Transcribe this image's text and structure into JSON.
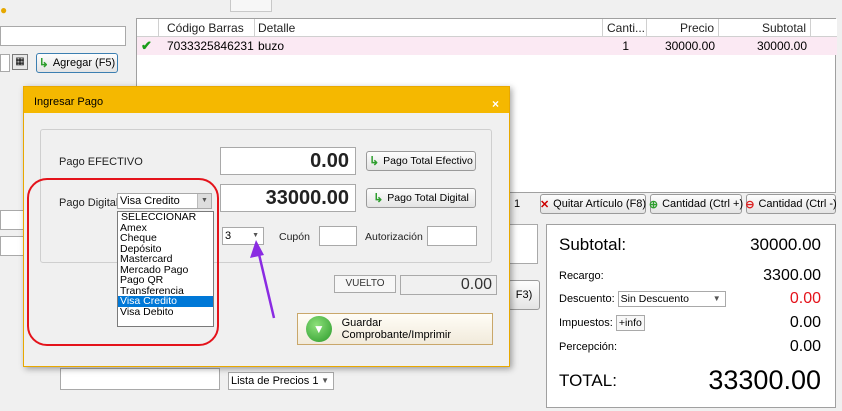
{
  "app": {
    "agregar_label": "Agregar (F5)",
    "calc_icon": "calculator-icon"
  },
  "grid": {
    "headers": [
      "Código Barras",
      "Detalle",
      "Canti...",
      "Precio",
      "Subtotal"
    ],
    "rows": [
      {
        "codigo": "7033325846231",
        "detalle": "buzo",
        "cantidad": "1",
        "precio": "30000.00",
        "subtotal": "30000.00"
      }
    ]
  },
  "toolbar": {
    "count": "1",
    "quitar": "Quitar Artículo (F8)",
    "cantidad_mas": "Cantidad (Ctrl +)",
    "cantidad_menos": "Cantidad (Ctrl -)"
  },
  "f3_label": "F3)",
  "totals": {
    "subtotal_label": "Subtotal:",
    "subtotal_value": "30000.00",
    "recargo_label": "Recargo:",
    "recargo_value": "3300.00",
    "descuento_label": "Descuento:",
    "descuento_select": "Sin Descuento",
    "descuento_value": "0.00",
    "impuestos_label": "Impuestos:",
    "impuestos_btn": "+info",
    "impuestos_value": "0.00",
    "percepcion_label": "Percepción:",
    "percepcion_value": "0.00",
    "total_label": "TOTAL:",
    "total_value": "33300.00"
  },
  "lista_precios": "Lista de Precios 1",
  "dialog": {
    "title": "Ingresar Pago",
    "close": "×",
    "efectivo_label": "Pago EFECTIVO",
    "efectivo_value": "0.00",
    "total_efectivo_btn": "Pago Total Efectivo",
    "digital_label": "Pago Digital",
    "digital_select": "Visa Credito",
    "digital_value": "33000.00",
    "total_digital_btn": "Pago Total Digital",
    "cuotas_value": "3",
    "cupon_label": "Cupón",
    "autorizacion_label": "Autorización",
    "vuelto_label": "VUELTO",
    "vuelto_value": "0.00",
    "guardar_label": "Guardar Comprobante/Imprimir",
    "options": [
      "SELECCIONAR",
      "Amex",
      "Cheque",
      "Depósito",
      "Mastercard",
      "Mercado Pago",
      "Pago QR",
      "Transferencia",
      "Visa Credito",
      "Visa Debito"
    ],
    "selected_option": "Visa Credito"
  },
  "colors": {
    "title_bar": "#f5b800",
    "annotation_ring": "#e4131b",
    "annotation_arrow": "#8a2be2",
    "selection": "#0078d7",
    "discount_value": "#e4131b"
  }
}
